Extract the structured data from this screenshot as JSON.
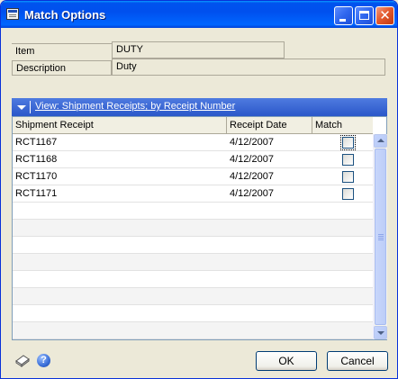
{
  "window": {
    "title": "Match Options",
    "controls": {
      "minimize": "minimize",
      "maximize": "maximize",
      "close": "✕"
    }
  },
  "fields": {
    "item_label": "Item",
    "item_value": "DUTY",
    "description_label": "Description",
    "description_value": "Duty"
  },
  "view": {
    "label": "View: Shipment Receipts; by Receipt Number"
  },
  "grid": {
    "columns": [
      "Shipment Receipt",
      "Receipt Date",
      "Match"
    ],
    "rows": [
      {
        "receipt": "RCT1167",
        "date": "4/12/2007",
        "match": false
      },
      {
        "receipt": "RCT1168",
        "date": "4/12/2007",
        "match": false
      },
      {
        "receipt": "RCT1170",
        "date": "4/12/2007",
        "match": false
      },
      {
        "receipt": "RCT1171",
        "date": "4/12/2007",
        "match": false
      }
    ]
  },
  "buttons": {
    "ok": "OK",
    "cancel": "Cancel"
  },
  "icons": {
    "note": "note-icon",
    "help": "help-icon",
    "help_glyph": "?"
  }
}
